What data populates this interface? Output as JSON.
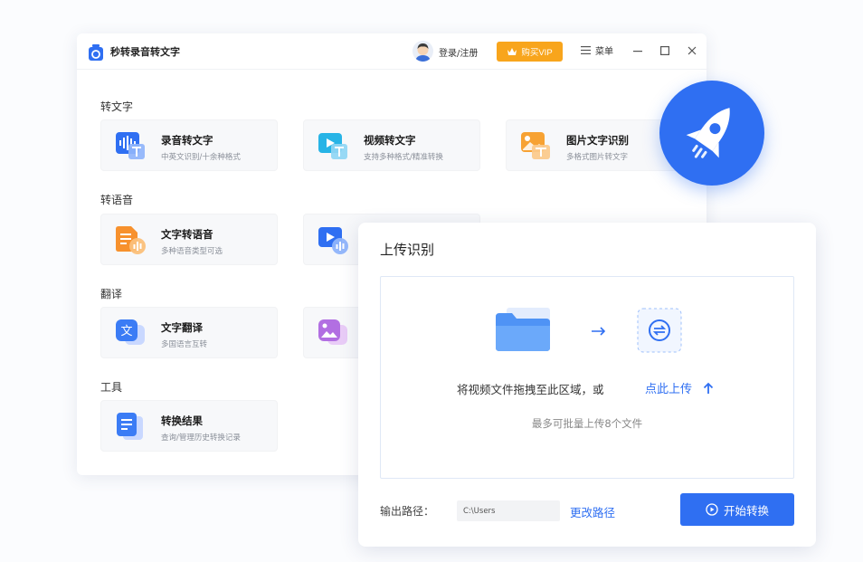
{
  "window": {
    "title": "秒转录音转文字",
    "login_label": "登录/注册",
    "vip_label": "购买VIP",
    "menu_label": "菜单"
  },
  "sections": {
    "to_text": "转文字",
    "to_speech": "转语音",
    "translate": "翻译",
    "tools": "工具"
  },
  "cards": {
    "audio_to_text": {
      "title": "录音转文字",
      "subtitle": "中英文识别/十余种格式"
    },
    "video_to_text": {
      "title": "视频转文字",
      "subtitle": "支持多种格式/精准转换"
    },
    "image_ocr": {
      "title": "图片文字识别",
      "subtitle": "多格式图片转文字"
    },
    "text_to_speech": {
      "title": "文字转语音",
      "subtitle": "多种语音类型可选"
    },
    "text_translate": {
      "title": "文字翻译",
      "subtitle": "多国语言互转"
    },
    "convert_results": {
      "title": "转换结果",
      "subtitle": "查询/管理历史转换记录"
    }
  },
  "upload": {
    "title": "上传识别",
    "drag_text": "将视频文件拖拽至此区域，或",
    "upload_link": "点此上传",
    "limit_text": "最多可批量上传8个文件",
    "output_label": "输出路径：",
    "output_path": "C:\\Users",
    "change_path": "更改路径",
    "start_label": "开始转换"
  },
  "colors": {
    "accent": "#2f6ff2",
    "vip": "#f8a51c"
  }
}
